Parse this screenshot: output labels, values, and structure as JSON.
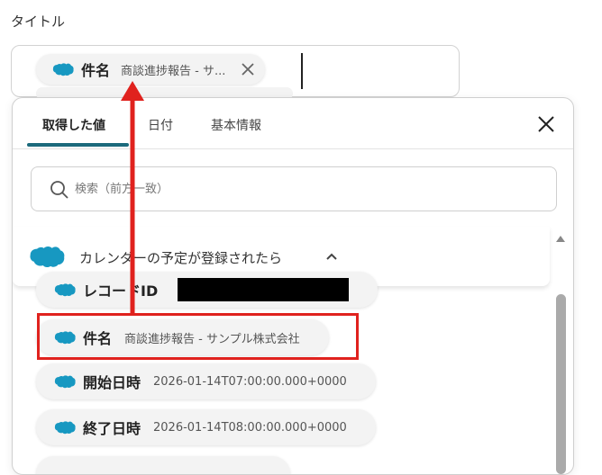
{
  "field": {
    "label": "タイトル"
  },
  "title_chip": {
    "name": "件名",
    "value": "商談進捗報告 - サ..."
  },
  "tabs": [
    {
      "label": "取得した値",
      "active": true
    },
    {
      "label": "日付",
      "active": false
    },
    {
      "label": "基本情報",
      "active": false
    }
  ],
  "search": {
    "placeholder": "検索（前方一致）",
    "value": ""
  },
  "section": {
    "label": "カレンダーの予定が登録されたら",
    "expanded": true
  },
  "items": [
    {
      "name": "レコードID",
      "value": "",
      "redacted": true
    },
    {
      "name": "件名",
      "value": "商談進捗報告 - サンプル株式会社",
      "highlighted": true
    },
    {
      "name": "開始日時",
      "value": "2026-01-14T07:00:00.000+0000"
    },
    {
      "name": "終了日時",
      "value": "2026-01-14T08:00:00.000+0000"
    }
  ],
  "colors": {
    "salesforce_cloud": "#1798c1",
    "tab_underline": "#1c6a7c",
    "annotation_red": "#e0221e"
  },
  "icons": [
    "salesforce-cloud-icon",
    "close-icon",
    "search-icon",
    "chevron-up-icon",
    "scroll-up-icon"
  ]
}
